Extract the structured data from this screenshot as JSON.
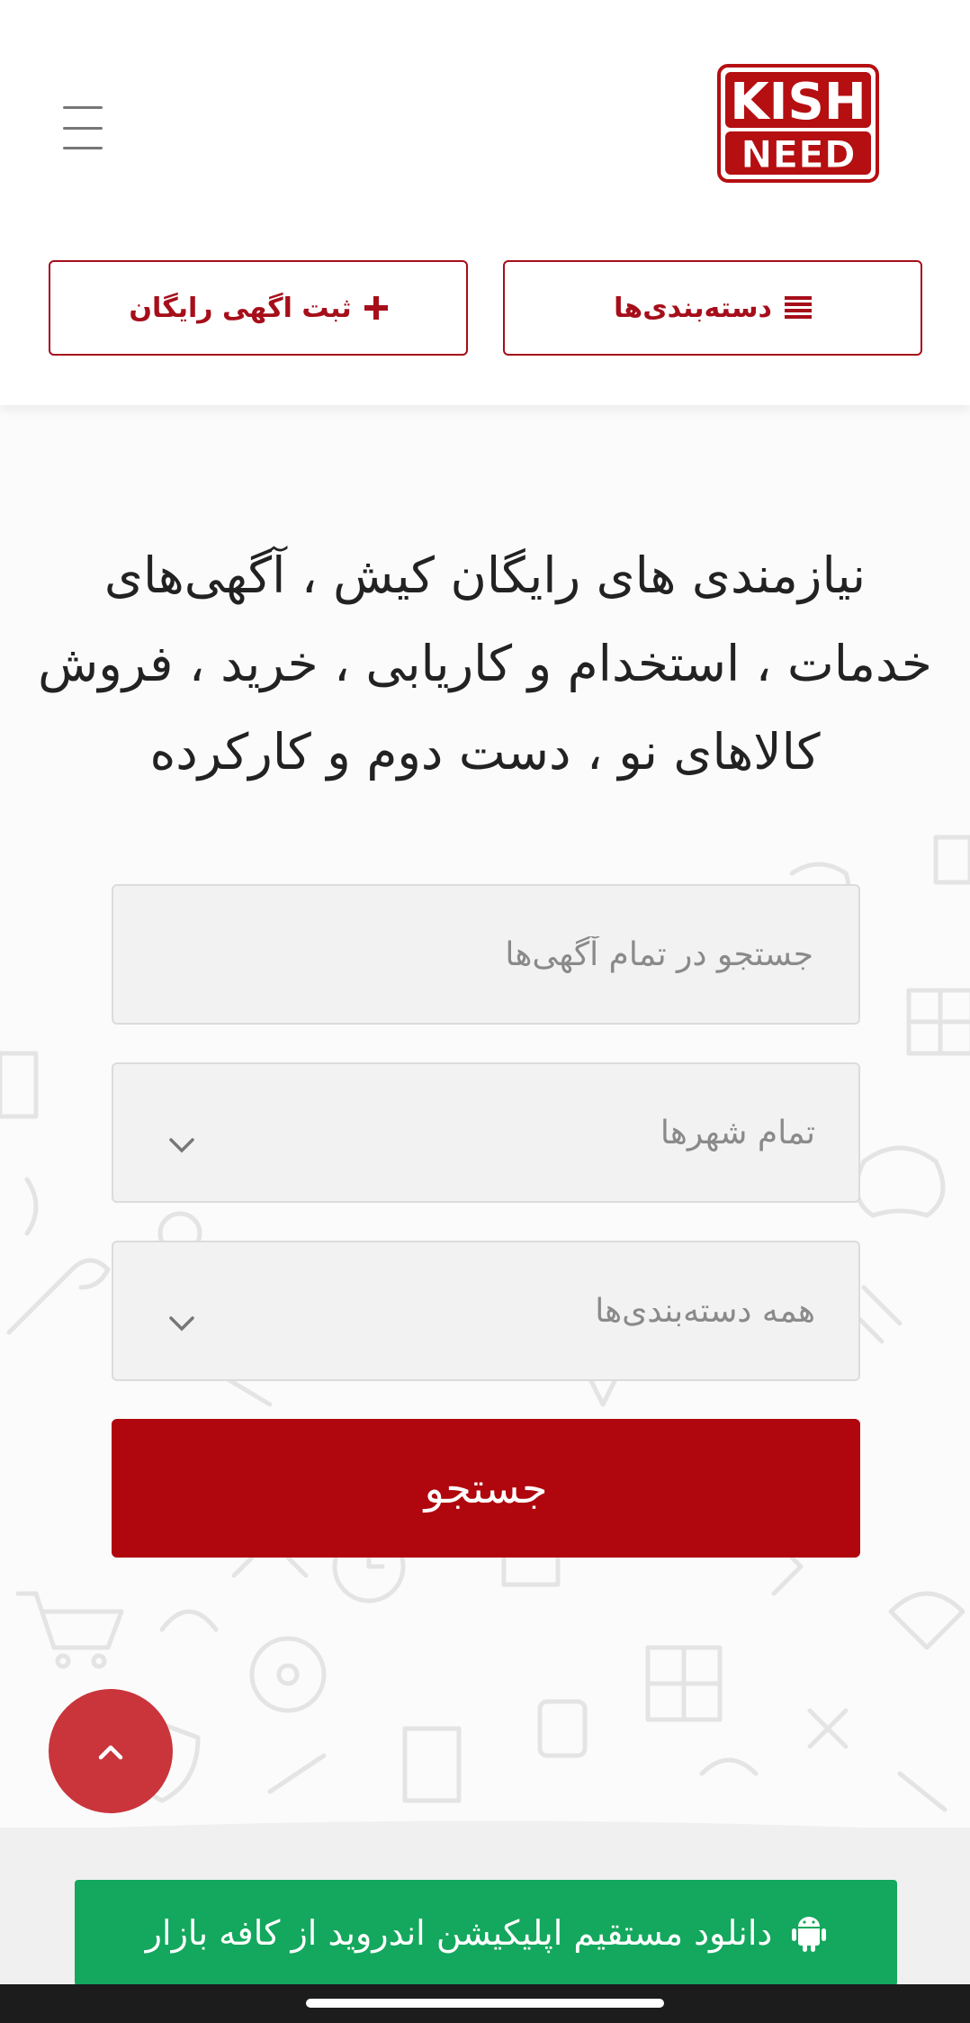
{
  "header": {
    "logo": {
      "line1": "KISH",
      "line2": "NEED",
      "color": "#b50f12"
    },
    "menu_icon": "hamburger-icon",
    "categories_button": {
      "label": "دسته‌بندی‌ها",
      "icon": "list-icon"
    },
    "post_ad_button": {
      "label": "ثبت اگهی رایگان",
      "icon": "plus-icon"
    }
  },
  "hero": {
    "headline": "نیازمندی های رایگان کیش ، آگهی‌های خدمات ، استخدام و کاریابی ، خرید ، فروش کالاهای نو ، دست دوم و کارکرده"
  },
  "search": {
    "query_placeholder": "جستجو در تمام آگهی‌ها",
    "query_value": "",
    "city_selected": "تمام شهرها",
    "category_selected": "همه دسته‌بندی‌ها",
    "submit_label": "جستجو"
  },
  "footer": {
    "app_banner_label": "دانلود مستقیم اپلیکیشن اندروید از کافه بازار",
    "app_banner_icon": "android-icon"
  },
  "colors": {
    "brand_red": "#a60e1a",
    "search_button": "#b0060d",
    "scroll_top": "#c9353b",
    "app_banner": "#13a85d"
  }
}
